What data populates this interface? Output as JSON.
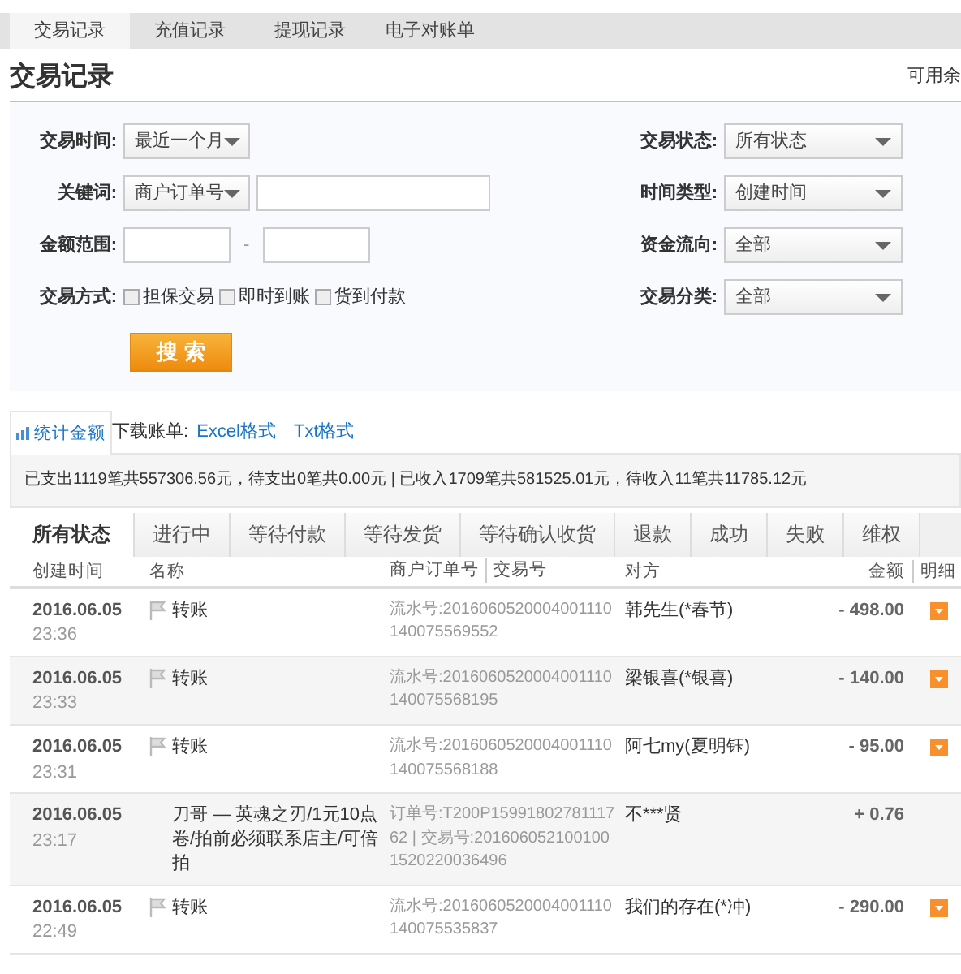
{
  "top_tabs": [
    {
      "label": "交易记录",
      "selected": true
    },
    {
      "label": "充值记录",
      "selected": false
    },
    {
      "label": "提现记录",
      "selected": false
    },
    {
      "label": "电子对账单",
      "selected": false
    }
  ],
  "heading": "交易记录",
  "balance_label": "可用余",
  "filters_left": [
    {
      "kind": "select",
      "label": "交易时间:",
      "value": "最近一个月"
    },
    {
      "kind": "keyword",
      "label": "关键词:",
      "value": "商户订单号"
    },
    {
      "kind": "range",
      "label": "金额范围:",
      "separator": "-"
    },
    {
      "kind": "checks",
      "label": "交易方式:",
      "options": [
        {
          "label": "担保交易",
          "checked": false
        },
        {
          "label": "即时到账",
          "checked": false
        },
        {
          "label": "货到付款",
          "checked": false
        }
      ]
    }
  ],
  "filters_right": [
    {
      "label": "交易状态:",
      "value": "所有状态"
    },
    {
      "label": "时间类型:",
      "value": "创建时间"
    },
    {
      "label": "资金流向:",
      "value": "全部"
    },
    {
      "label": "交易分类:",
      "value": "全部"
    }
  ],
  "search_button": "搜 索",
  "stats_tab": "统计金额",
  "download_label": "下载账单:",
  "download_links": [
    "Excel格式",
    "Txt格式"
  ],
  "summary": "已支出1119笔共557306.56元，待支出0笔共0.00元 | 已收入1709笔共581525.01元，待收入11笔共11785.12元",
  "status_tabs": [
    {
      "label": "所有状态",
      "selected": true
    },
    {
      "label": "进行中",
      "selected": false
    },
    {
      "label": "等待付款",
      "selected": false
    },
    {
      "label": "等待发货",
      "selected": false
    },
    {
      "label": "等待确认收货",
      "selected": false
    },
    {
      "label": "退款",
      "selected": false
    },
    {
      "label": "成功",
      "selected": false
    },
    {
      "label": "失败",
      "selected": false
    },
    {
      "label": "维权",
      "selected": false
    }
  ],
  "table": {
    "columns": [
      "创建时间",
      "名称",
      "商户订单号",
      "交易号",
      "对方",
      "金额",
      "明细"
    ],
    "rows": [
      {
        "date": "2016.06.05",
        "time": "23:36",
        "flag": true,
        "name": "转账",
        "reference": "流水号:2016060520004001110140075569552",
        "party": "韩先生(*春节)",
        "amount": "- 498.00",
        "expandable": true
      },
      {
        "date": "2016.06.05",
        "time": "23:33",
        "flag": true,
        "name": "转账",
        "reference": "流水号:2016060520004001110140075568195",
        "party": "梁银喜(*银喜)",
        "amount": "- 140.00",
        "expandable": true
      },
      {
        "date": "2016.06.05",
        "time": "23:31",
        "flag": true,
        "name": "转账",
        "reference": "流水号:2016060520004001110140075568188",
        "party": "阿七my(夏明钰)",
        "amount": "- 95.00",
        "expandable": true
      },
      {
        "date": "2016.06.05",
        "time": "23:17",
        "flag": false,
        "name": "刀哥 — 英魂之刃/1元10点卷/拍前必须联系店主/可倍拍",
        "reference": "订单号:T200P1599180278111762 | 交易号:2016060521001001520220036496",
        "party": "不***贤",
        "amount": "+ 0.76",
        "expandable": false
      },
      {
        "date": "2016.06.05",
        "time": "22:49",
        "flag": true,
        "name": "转账",
        "reference": "流水号:2016060520004001110140075535837",
        "party": "我们的存在(*冲)",
        "amount": "- 290.00",
        "expandable": true
      }
    ]
  }
}
